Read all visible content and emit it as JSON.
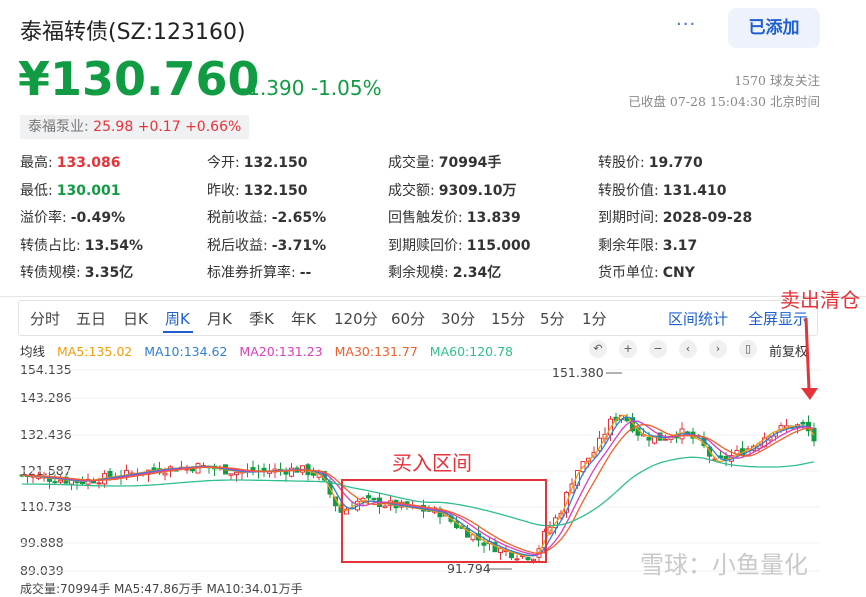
{
  "header": {
    "title": "泰福转债(SZ:123160)",
    "more": "···",
    "added_button": "已添加",
    "price": "¥130.760",
    "change": "-1.390 -1.05%",
    "followers": "1570 球友关注",
    "status": "已收盘 07-28 15:04:30 北京时间"
  },
  "underlying": {
    "name": "泰福泵业:",
    "price": "25.98",
    "change": "+0.17",
    "pct": "+0.66%"
  },
  "stats": [
    [
      {
        "label": "最高:",
        "value": "133.086"
      },
      {
        "label": "今开:",
        "value": "132.150"
      },
      {
        "label": "成交量:",
        "value": "70994手"
      },
      {
        "label": "转股价:",
        "value": "19.770"
      }
    ],
    [
      {
        "label": "最低:",
        "value": "130.001"
      },
      {
        "label": "昨收:",
        "value": "132.150"
      },
      {
        "label": "成交额:",
        "value": "9309.10万"
      },
      {
        "label": "转股价值:",
        "value": "131.410"
      }
    ],
    [
      {
        "label": "溢价率:",
        "value": "-0.49%"
      },
      {
        "label": "税前收益:",
        "value": "-2.65%"
      },
      {
        "label": "回售触发价:",
        "value": "13.839"
      },
      {
        "label": "到期时间:",
        "value": "2028-09-28"
      }
    ],
    [
      {
        "label": "转债占比:",
        "value": "13.54%"
      },
      {
        "label": "税后收益:",
        "value": "-3.71%"
      },
      {
        "label": "到期赎回价:",
        "value": "115.000"
      },
      {
        "label": "剩余年限:",
        "value": "3.17"
      }
    ],
    [
      {
        "label": "转债规模:",
        "value": "3.35亿"
      },
      {
        "label": "标准券折算率:",
        "value": "--"
      },
      {
        "label": "剩余规模:",
        "value": "2.34亿"
      },
      {
        "label": "货币单位:",
        "value": "CNY"
      }
    ]
  ],
  "tabs": [
    "分时",
    "五日",
    "日K",
    "周K",
    "月K",
    "季K",
    "年K",
    "120分",
    "60分",
    "30分",
    "15分",
    "5分",
    "1分"
  ],
  "tab_actions": [
    "区间统计",
    "全屏显示"
  ],
  "ma_legend": {
    "title": "均线",
    "items": [
      {
        "label": "MA5:135.02",
        "color": "#f39c12"
      },
      {
        "label": "MA10:134.62",
        "color": "#2f7fd6"
      },
      {
        "label": "MA20:131.23",
        "color": "#d63fbf"
      },
      {
        "label": "MA30:131.77",
        "color": "#f0602a"
      },
      {
        "label": "MA60:120.78",
        "color": "#2fbf8f"
      }
    ]
  },
  "toolbar": {
    "icons": [
      "undo-icon",
      "zoom-in-icon",
      "zoom-out-icon",
      "pan-left-icon",
      "pan-right-icon",
      "candle-type-icon"
    ],
    "restore_label": "前复权"
  },
  "chart_data": {
    "type": "candlestick",
    "y_ticks": [
      "154.135",
      "143.286",
      "132.436",
      "121.587",
      "110.738",
      "99.888",
      "89.039"
    ],
    "high_label": "151.380",
    "low_label": "91.794",
    "ylim": [
      89.039,
      154.135
    ]
  },
  "annotations": {
    "buy_zone": "买入区间",
    "sell": "卖出清仓"
  },
  "volume_label": "成交量:70994手  MA5:47.86万手  MA10:34.01万手",
  "watermark": "雪球：小鱼量化",
  "colors": {
    "up": "#e5333a",
    "down": "#119c44",
    "accent": "#1f5fcf"
  }
}
